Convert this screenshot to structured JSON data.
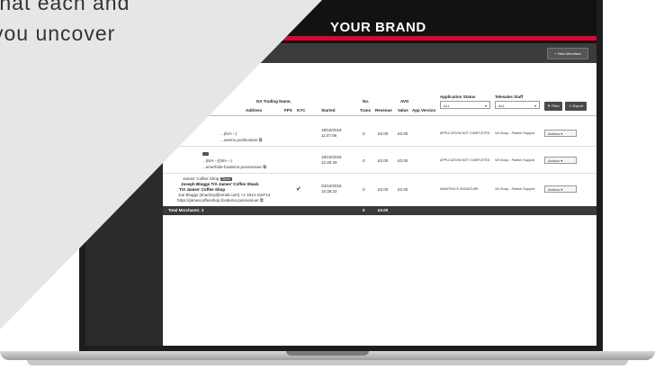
{
  "headline": {
    "line1": "that each and",
    "line2": "you uncover"
  },
  "app": {
    "brand": "YOUR BRAND",
    "new_merchant_label": "+ New Merchant"
  },
  "table": {
    "headers": {
      "trading_name": "DA Trading Name,",
      "address": "Address",
      "fps": "FPS",
      "kyc": "KYC",
      "started": "Started",
      "no": "No.",
      "trans": "Trans",
      "revenue": "Revenue",
      "avg": "AVG",
      "value": "Value",
      "app_version": "App Version",
      "application_status": "Application Status",
      "telesales_staff": "Telesales Staff"
    },
    "filters": {
      "status": "ALL",
      "staff": "ALL"
    },
    "filter_button": "Filter",
    "export_button": "Export",
    "rows": [
      {
        "line1": "...(N/A --)",
        "line2": "...osemo.poshiosiuer",
        "started_date": "19/10/2018",
        "started_time": "11:47:06",
        "trans": "0",
        "revenue": "£0.00",
        "avg": "£0.00",
        "status": "APPLICATION NOT COMPLETED",
        "staff": "V8 Group - Partner Support",
        "actions": "Actions"
      },
      {
        "line1": "...(N/A --)(N/A --)",
        "line2": "...emerhide-fosdemo.posreosiuer",
        "started_date": "19/10/2018",
        "started_time": "12:40:29",
        "trans": "0",
        "revenue": "£0.00",
        "avg": "£0.00",
        "status": "APPLICATION NOT COMPLETED",
        "staff": "V8 Group - Partner Support",
        "actions": "Actions"
      },
      {
        "badge_name": "James' Coffee Shop",
        "badge": "Demo",
        "line_bold1": "Joseph Bloggs T/A James' Coffee Shack",
        "line_bold2": "T/A James' Coffee Shop",
        "line_email": "Joe Bloggs (shacboy@email.com) +1 1614 418713",
        "line_url": "https://jamescoffeeshop.fosdemo.posreosiuer",
        "kyc": "✔",
        "started_date": "03/10/2018",
        "started_time": "15:35:22",
        "trans": "0",
        "revenue": "£0.00",
        "avg": "£0.00",
        "status": "AWAITING E-SIGNATURE",
        "staff": "V8 Group - Partner Support",
        "actions": "Actions"
      }
    ],
    "total_label": "Total Merchants: 3",
    "total_trans": "0",
    "total_revenue": "£0.00"
  },
  "colors": {
    "accent": "#cf0a35",
    "overlay": "#e6e6e6",
    "chrome_dark": "#121212"
  }
}
